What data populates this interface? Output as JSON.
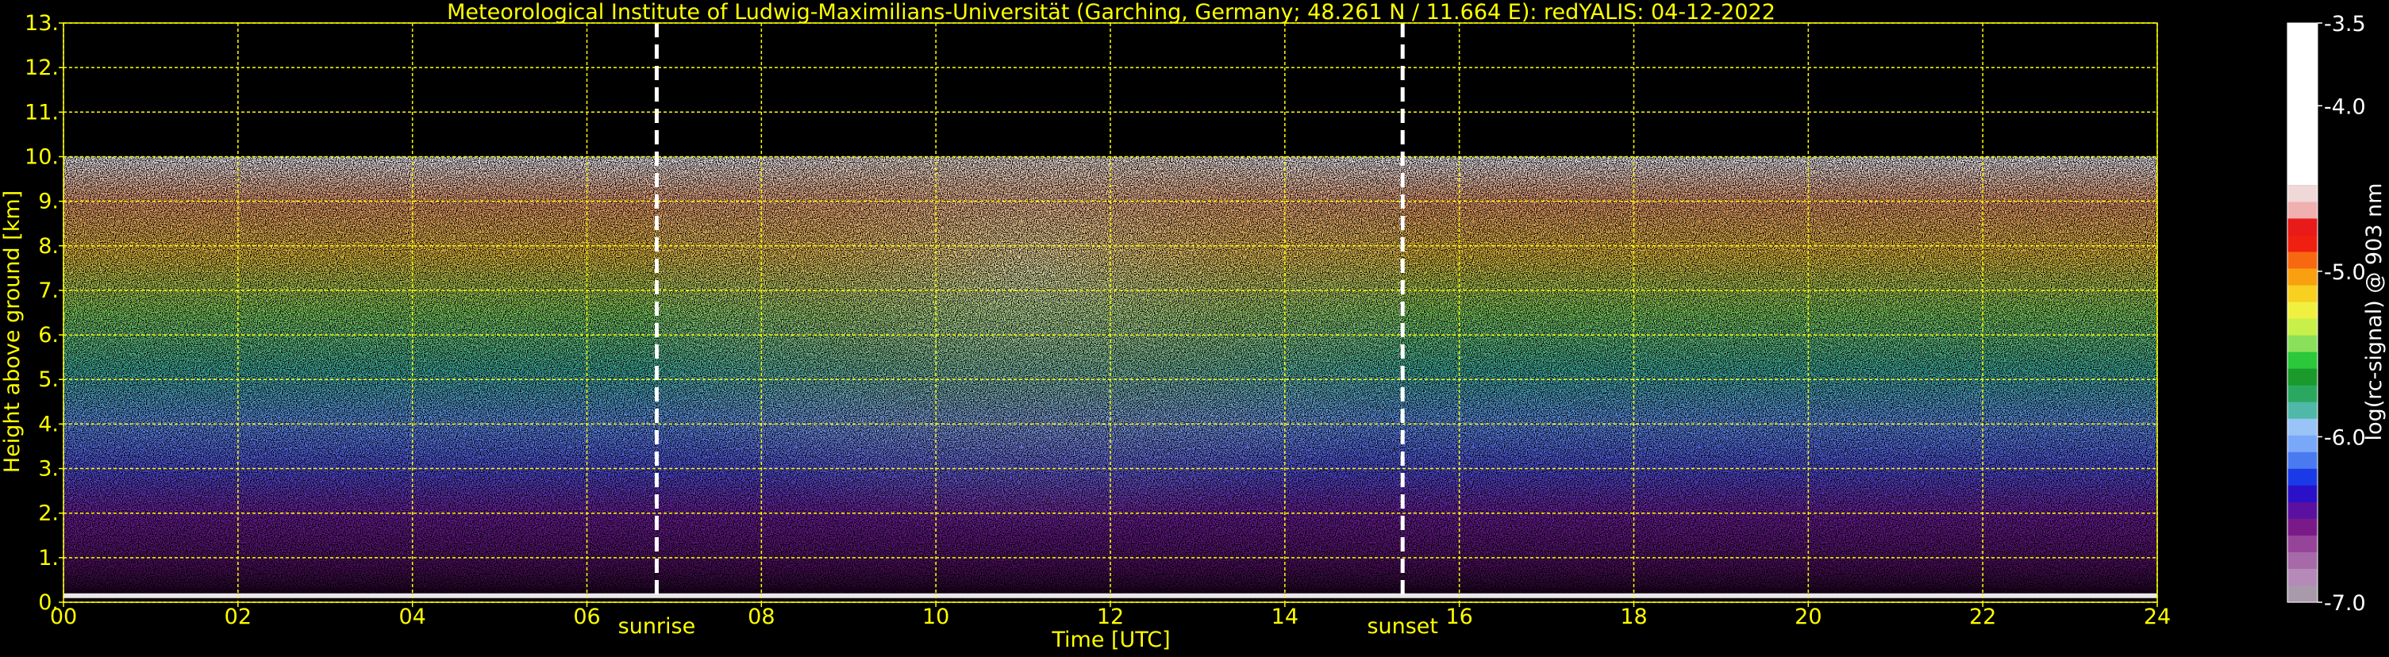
{
  "chart_data": {
    "type": "heatmap",
    "title": "Meteorological Institute of Ludwig-Maximilians-Universität (Garching, Germany; 48.261 N / 11.664 E):    redYALIS: 04-12-2022",
    "xlabel": "Time [UTC]",
    "ylabel": "Height above ground [km]",
    "xlim": [
      0,
      24
    ],
    "ylim": [
      0,
      13
    ],
    "x_tick_labels": [
      "00",
      "02",
      "04",
      "06",
      "08",
      "10",
      "12",
      "14",
      "16",
      "18",
      "20",
      "22",
      "24"
    ],
    "y_tick_labels": [
      "0.",
      "1.",
      "2.",
      "3.",
      "4.",
      "5.",
      "6.",
      "7.",
      "8.",
      "9.",
      "10.",
      "11.",
      "12.",
      "13."
    ],
    "grid": true,
    "grid_color": "#ffff00",
    "data_top_km": 10,
    "events": [
      {
        "label": "sunrise",
        "time_h": 6.8
      },
      {
        "label": "sunset",
        "time_h": 15.35
      }
    ],
    "colorbar": {
      "label": "log(rc-signal) @ 903 nm",
      "range": [
        -7.0,
        -3.5
      ],
      "tick_labels": [
        "-3.5",
        "-4.0",
        "-5.0",
        "-6.0",
        "-7.0"
      ],
      "tick_values": [
        -3.5,
        -4.0,
        -5.0,
        -6.0,
        -7.0
      ]
    }
  },
  "colors": {
    "axis_text": "#ffff00",
    "background": "#000000",
    "colorbar_text": "#ffffff",
    "colormap": [
      "#a89aaa",
      "#b58ab8",
      "#a66aa8",
      "#96449a",
      "#7a1a88",
      "#5a10a0",
      "#2a10c8",
      "#1a3ae8",
      "#4a7af0",
      "#7aa8f8",
      "#9ac4f8",
      "#50b8a8",
      "#2aa860",
      "#1a9a2a",
      "#2ac83a",
      "#8ae05a",
      "#c8f04a",
      "#f0f040",
      "#f8d020",
      "#f8a010",
      "#f86810",
      "#f02010",
      "#e81a1a",
      "#f0b0b0",
      "#f0d8d8",
      "#ffffff"
    ]
  }
}
